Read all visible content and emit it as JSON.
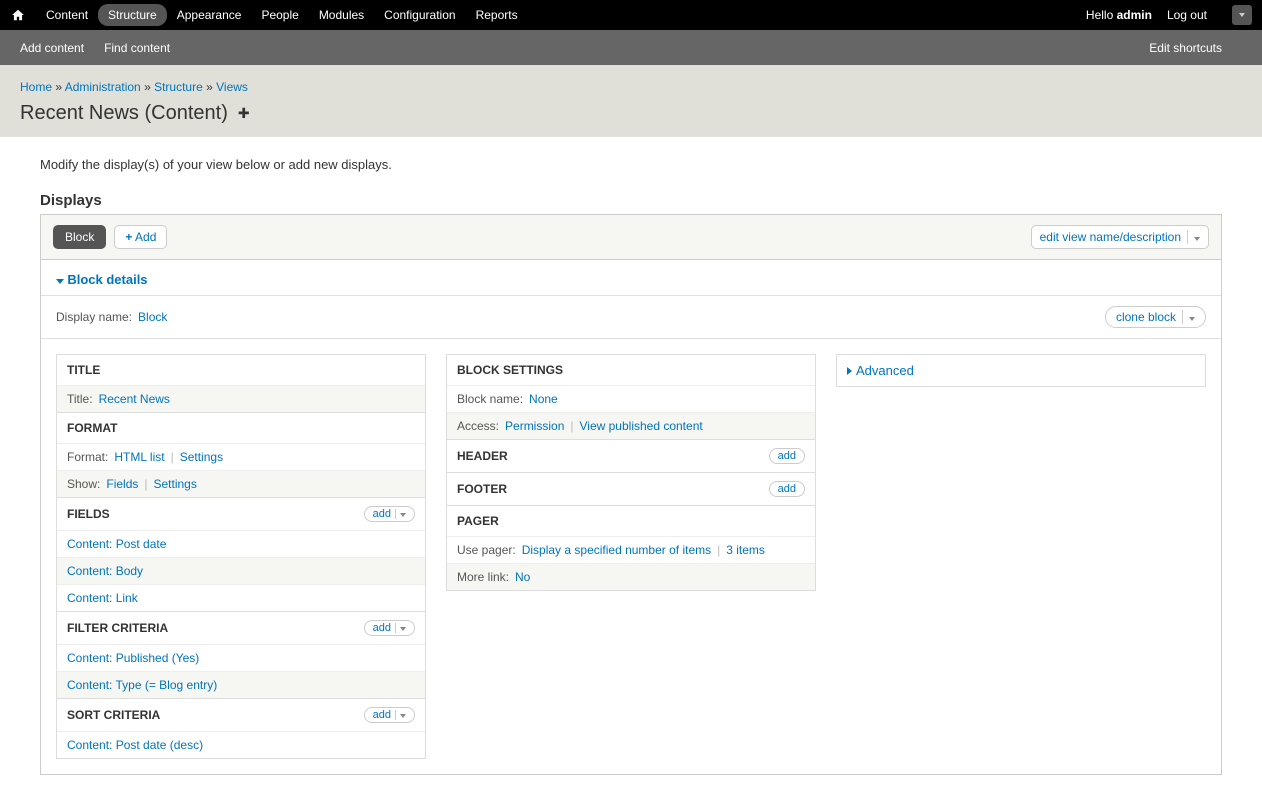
{
  "toolbar": {
    "menu": [
      "Content",
      "Structure",
      "Appearance",
      "People",
      "Modules",
      "Configuration",
      "Reports"
    ],
    "active_index": 1,
    "hello": "Hello",
    "username": "admin",
    "logout": "Log out"
  },
  "shortcuts": {
    "add_content": "Add content",
    "find_content": "Find content",
    "edit_shortcuts": "Edit shortcuts"
  },
  "breadcrumb": {
    "home": "Home",
    "administration": "Administration",
    "structure": "Structure",
    "views": "Views"
  },
  "page_title": "Recent News (Content)",
  "intro": "Modify the display(s) of your view below or add new displays.",
  "displays_label": "Displays",
  "tabs": {
    "block": "Block",
    "add": "Add",
    "edit_view": "edit view name/description"
  },
  "block_details_label": "Block details",
  "display_name": {
    "label": "Display name:",
    "value": "Block"
  },
  "clone_label": "clone block",
  "col1": {
    "title_header": "TITLE",
    "title_label": "Title:",
    "title_value": "Recent News",
    "format_header": "FORMAT",
    "format_label": "Format:",
    "format_value": "HTML list",
    "format_settings": "Settings",
    "show_label": "Show:",
    "show_value": "Fields",
    "show_settings": "Settings",
    "fields_header": "FIELDS",
    "fields": [
      "Content: Post date",
      "Content: Body",
      "Content: Link"
    ],
    "filter_header": "FILTER CRITERIA",
    "filters": [
      "Content: Published (Yes)",
      "Content: Type (= Blog entry)"
    ],
    "sort_header": "SORT CRITERIA",
    "sorts": [
      "Content: Post date (desc)"
    ]
  },
  "col2": {
    "block_settings_header": "BLOCK SETTINGS",
    "block_name_label": "Block name:",
    "block_name_value": "None",
    "access_label": "Access:",
    "access_value": "Permission",
    "access_setting": "View published content",
    "header_header": "HEADER",
    "footer_header": "FOOTER",
    "pager_header": "PAGER",
    "use_pager_label": "Use pager:",
    "use_pager_value": "Display a specified number of items",
    "use_pager_setting": "3 items",
    "more_link_label": "More link:",
    "more_link_value": "No"
  },
  "advanced_label": "Advanced",
  "add_label": "add"
}
